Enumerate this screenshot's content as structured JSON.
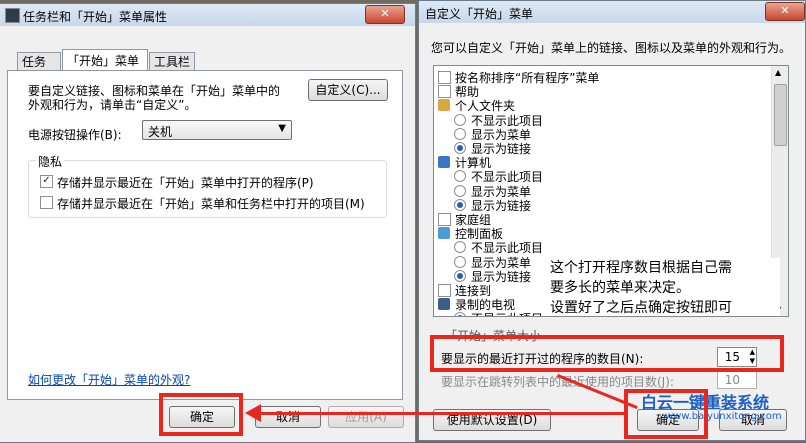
{
  "left_window": {
    "title": "任务栏和「开始」菜单属性",
    "close": "✕",
    "tabs": [
      "任务栏",
      "「开始」菜单",
      "工具栏"
    ],
    "desc_line1": "要自定义链接、图标和菜单在「开始」菜单中的",
    "desc_line2": "外观和行为，请单击“自定义”。",
    "customize_button": "自定义(C)...",
    "power_label": "电源按钮操作(B):",
    "power_value": "关机",
    "privacy_group": "隐私",
    "privacy_check1": "存储并显示最近在「开始」菜单中打开的程序(P)",
    "privacy_check2": "存储并显示最近在「开始」菜单和任务栏中打开的项目(M)",
    "appearance_link": "如何更改「开始」菜单的外观?",
    "ok": "确定",
    "cancel": "取消",
    "apply": "应用(A)"
  },
  "right_window": {
    "title": "自定义「开始」菜单",
    "close": "✕",
    "description": "您可以自定义「开始」菜单上的链接、图标以及菜单的外观和行为。",
    "list": [
      {
        "kind": "check",
        "label": "按名称排序“所有程序”菜单",
        "checked": false,
        "level": 0
      },
      {
        "kind": "check",
        "label": "帮助",
        "checked": false,
        "level": 0
      },
      {
        "kind": "head",
        "label": "个人文件夹",
        "icon": "folder-icon",
        "level": 0
      },
      {
        "kind": "radio",
        "label": "不显示此项目",
        "checked": false,
        "level": 1
      },
      {
        "kind": "radio",
        "label": "显示为菜单",
        "checked": false,
        "level": 1
      },
      {
        "kind": "radio",
        "label": "显示为链接",
        "checked": true,
        "level": 1
      },
      {
        "kind": "head",
        "label": "计算机",
        "icon": "computer-icon",
        "level": 0
      },
      {
        "kind": "radio",
        "label": "不显示此项目",
        "checked": false,
        "level": 1
      },
      {
        "kind": "radio",
        "label": "显示为菜单",
        "checked": false,
        "level": 1
      },
      {
        "kind": "radio",
        "label": "显示为链接",
        "checked": true,
        "level": 1
      },
      {
        "kind": "check",
        "label": "家庭组",
        "checked": false,
        "level": 0
      },
      {
        "kind": "head",
        "label": "控制面板",
        "icon": "control-panel-icon",
        "level": 0
      },
      {
        "kind": "radio",
        "label": "不显示此项目",
        "checked": false,
        "level": 1
      },
      {
        "kind": "radio",
        "label": "显示为菜单",
        "checked": false,
        "level": 1
      },
      {
        "kind": "radio",
        "label": "显示为链接",
        "checked": true,
        "level": 1
      },
      {
        "kind": "check",
        "label": "连接到",
        "checked": false,
        "level": 0
      },
      {
        "kind": "head",
        "label": "录制的电视",
        "icon": "tv-icon",
        "level": 0
      },
      {
        "kind": "radio",
        "label": "不显示此项目",
        "checked": true,
        "level": 1
      }
    ],
    "annotation_lines": [
      "这个打开程序数目根据自己需",
      "要多长的菜单来决定。",
      "设置好了之后点确定按钮即可"
    ],
    "menu_size_label": "「开始」菜单大小",
    "recent_programs_label": "要显示的最近打开过的程序的数目(N):",
    "recent_programs_value": "15",
    "jumplist_label": "要显示在跳转列表中的最近使用的项目数(J):",
    "jumplist_value": "10",
    "default_button": "使用默认设置(D)",
    "ok": "确定",
    "cancel": "取消",
    "watermark_brand": "白云一键重装系统",
    "watermark_url": "www.baiyunxitong.com"
  },
  "colors": {
    "highlight": "#e8271f",
    "link": "#0645ad",
    "accent": "#1f5fbf"
  }
}
